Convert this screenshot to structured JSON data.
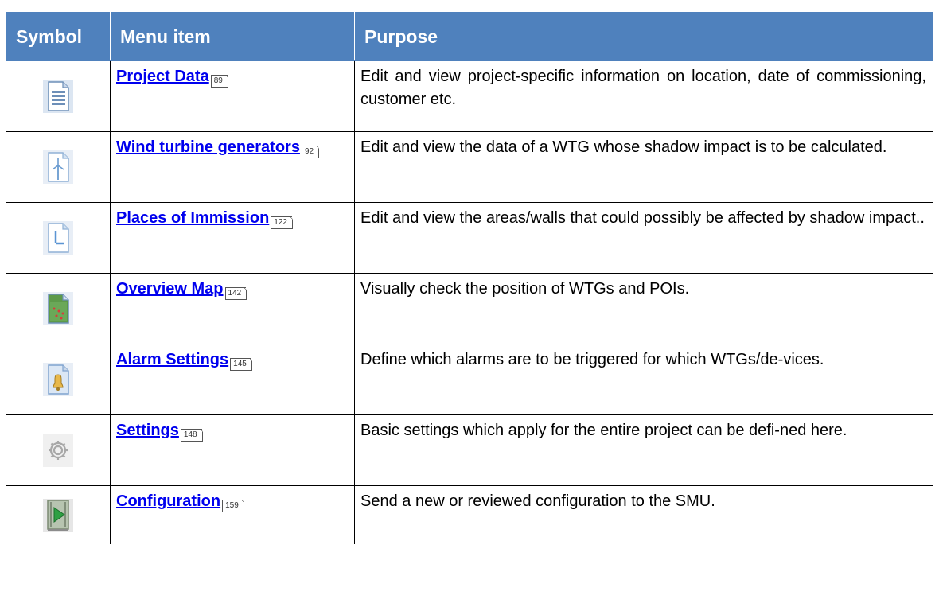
{
  "headers": {
    "symbol": "Symbol",
    "menu_item": "Menu item",
    "purpose": "Purpose"
  },
  "rows": [
    {
      "icon": "document-icon",
      "label": "Project Data",
      "page": "89",
      "purpose": "Edit and view project-specific information on location, date of commissioning, customer etc."
    },
    {
      "icon": "wind-turbine-icon",
      "label": "Wind turbine generators",
      "page": "92",
      "purpose": "Edit and view the data of a WTG whose shadow impact is to be calculated."
    },
    {
      "icon": "place-of-immission-icon",
      "label": "Places of Immission",
      "page": "122",
      "purpose": "Edit and view the areas/walls that could possibly be affected by shadow impact.."
    },
    {
      "icon": "map-icon",
      "label": "Overview Map",
      "page": "142",
      "purpose": "Visually check the position of WTGs and POIs."
    },
    {
      "icon": "bell-icon",
      "label": "Alarm Settings",
      "page": "145",
      "purpose": "Define which alarms are to be triggered for which WTGs/de-vices."
    },
    {
      "icon": "gear-icon",
      "label": "Settings",
      "page": "148",
      "purpose": "Basic settings which apply for the entire project can be defi-ned here."
    },
    {
      "icon": "play-icon",
      "label": "Configuration",
      "page": "159",
      "purpose": "Send a new or reviewed configuration to the SMU."
    }
  ],
  "colors": {
    "header_bg": "#4f81bd",
    "header_text": "#ffffff",
    "link": "#0000ee"
  }
}
